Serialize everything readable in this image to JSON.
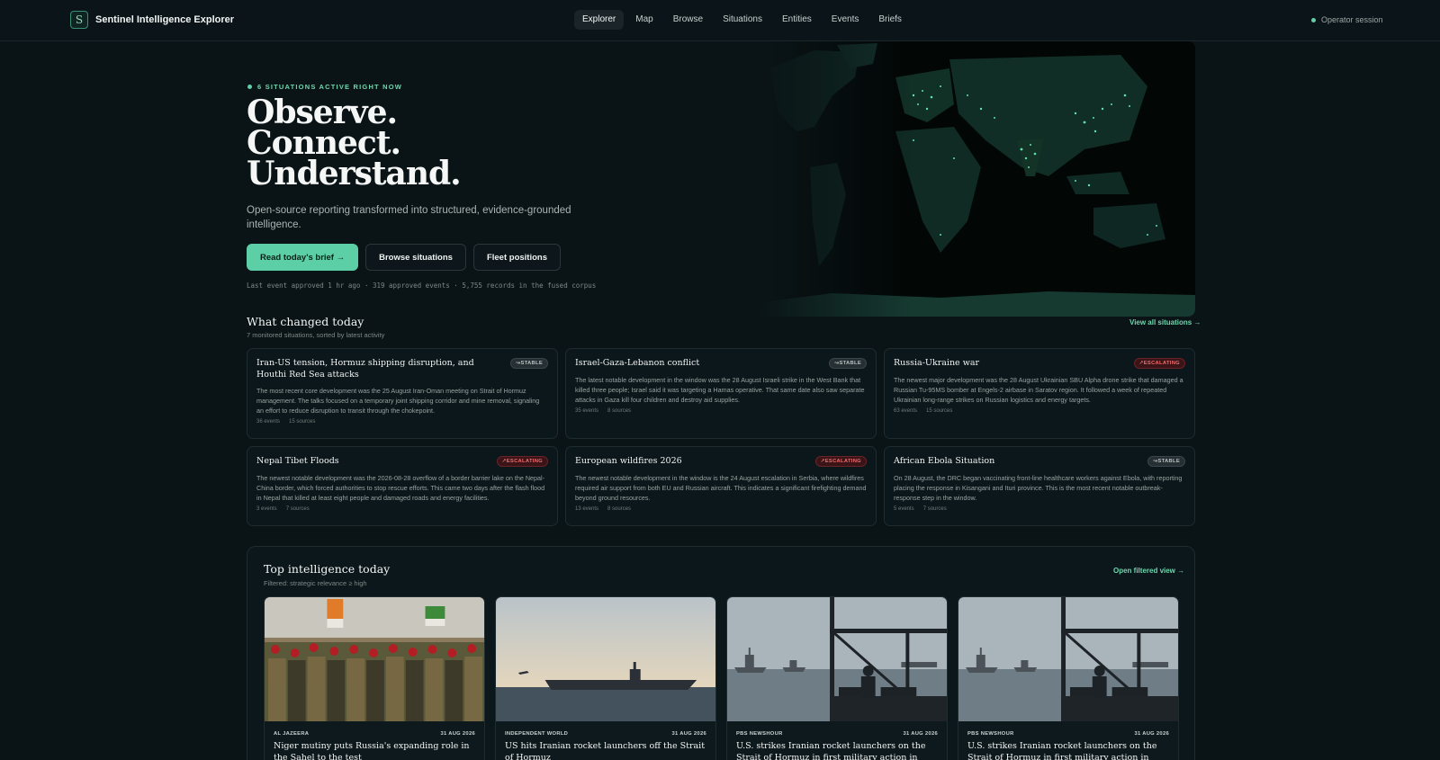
{
  "app": {
    "brand_letter": "S",
    "brand_name": "Sentinel Intelligence Explorer",
    "session": "Operator session"
  },
  "nav": [
    "Explorer",
    "Map",
    "Browse",
    "Situations",
    "Entities",
    "Events",
    "Briefs"
  ],
  "hero": {
    "kicker": "6 SITUATIONS ACTIVE RIGHT NOW",
    "title_lines": [
      "Observe.",
      "Connect.",
      "Understand."
    ],
    "subtitle": "Open-source reporting transformed into structured, evidence-grounded intelligence.",
    "buttons": {
      "primary": "Read today's brief →",
      "browse": "Browse situations",
      "fleet": "Fleet positions"
    },
    "meta": "Last event approved 1 hr ago · 319 approved events · 5,755 records in the fused corpus"
  },
  "changed": {
    "title": "What changed today",
    "subtitle": "7 monitored situations, sorted by latest activity",
    "link": "View all situations →",
    "cards": [
      {
        "title": "Iran-US tension, Hormuz shipping disruption, and Houthi Red Sea attacks",
        "status": "↝STABLE",
        "status_type": "stable",
        "body": "The most recent core development was the 25 August Iran-Oman meeting on Strait of Hormuz management. The talks focused on a temporary joint shipping corridor and mine removal, signaling an effort to reduce disruption to transit through the chokepoint.",
        "events": "36 events",
        "sources": "15 sources"
      },
      {
        "title": "Israel-Gaza-Lebanon conflict",
        "status": "↝STABLE",
        "status_type": "stable",
        "body": "The latest notable development in the window was the 28 August Israeli strike in the West Bank that killed three people; Israel said it was targeting a Hamas operative. That same date also saw separate attacks in Gaza kill four children and destroy aid supplies.",
        "events": "35 events",
        "sources": "8 sources"
      },
      {
        "title": "Russia-Ukraine war",
        "status": "↗ESCALATING",
        "status_type": "escalating",
        "body": "The newest major development was the 28 August Ukrainian SBU Alpha drone strike that damaged a Russian Tu-95MS bomber at Engels-2 airbase in Saratov region. It followed a week of repeated Ukrainian long-range strikes on Russian logistics and energy targets.",
        "events": "63 events",
        "sources": "15 sources"
      },
      {
        "title": "Nepal Tibet Floods",
        "status": "↗ESCALATING",
        "status_type": "escalating",
        "body": "The newest notable development was the 2026-08-28 overflow of a border barrier lake on the Nepal-China border, which forced authorities to stop rescue efforts. This came two days after the flash flood in Nepal that killed at least eight people and damaged roads and energy facilities.",
        "events": "3 events",
        "sources": "7 sources"
      },
      {
        "title": "European wildfires 2026",
        "status": "↗ESCALATING",
        "status_type": "escalating",
        "body": "The newest notable development in the window is the 24 August escalation in Serbia, where wildfires required air support from both EU and Russian aircraft. This indicates a significant firefighting demand beyond ground resources.",
        "events": "13 events",
        "sources": "8 sources"
      },
      {
        "title": "African Ebola Situation",
        "status": "↝STABLE",
        "status_type": "stable",
        "body": "On 28 August, the DRC began vaccinating front-line healthcare workers against Ebola, with reporting placing the response in Kisangani and Ituri province. This is the most recent notable outbreak-response step in the window.",
        "events": "5 events",
        "sources": "7 sources"
      }
    ]
  },
  "intel": {
    "title": "Top intelligence today",
    "subtitle": "Filtered: strategic relevance ≥ high",
    "link": "Open filtered view →",
    "cards": [
      {
        "source": "AL JAZEERA",
        "date": "31 AUG 2026",
        "title": "Niger mutiny puts Russia's expanding role in the Sahel to the test",
        "image": "soldiers-crowd-photo"
      },
      {
        "source": "INDEPENDENT WORLD",
        "date": "31 AUG 2026",
        "title": "US hits Iranian rocket launchers off the Strait of Hormuz",
        "image": "aircraft-carrier-photo"
      },
      {
        "source": "PBS NEWSHOUR",
        "date": "31 AUG 2026",
        "title": "U.S. strikes Iranian rocket launchers on the Strait of Hormuz in first military action in weeks",
        "image": "warships-pier-photo"
      },
      {
        "source": "PBS NEWSHOUR",
        "date": "31 AUG 2026",
        "title": "U.S. strikes Iranian rocket launchers on the Strait of Hormuz in first military action in weeks",
        "image": "warships-pier-photo"
      }
    ]
  }
}
